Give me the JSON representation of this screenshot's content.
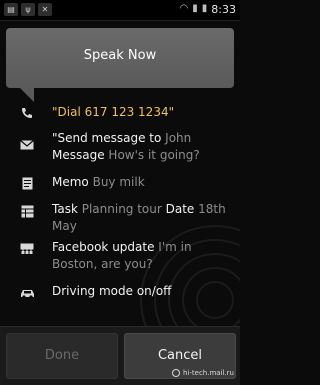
{
  "status_bar": {
    "time": "8:33",
    "left_icons": [
      "sim-icon",
      "usb-icon",
      "notification-icon"
    ],
    "right_icons": [
      "wifi-icon",
      "signal-icon",
      "battery-icon"
    ]
  },
  "prompt": {
    "title": "Speak Now"
  },
  "suggestions": [
    {
      "icon": "phone-icon",
      "parts": [
        {
          "text": "\"Dial ",
          "style": "y"
        },
        {
          "text": "617 123 1234\"",
          "style": "g"
        }
      ]
    },
    {
      "icon": "envelope-icon",
      "parts": [
        {
          "text": "\"Send message to ",
          "style": "w"
        },
        {
          "text": "John",
          "style": "g"
        },
        {
          "text": " Message ",
          "style": "w"
        },
        {
          "text": "How's it going?",
          "style": "g"
        }
      ]
    },
    {
      "icon": "memo-icon",
      "parts": [
        {
          "text": "Memo ",
          "style": "w"
        },
        {
          "text": "Buy milk",
          "style": "g"
        }
      ]
    },
    {
      "icon": "task-icon",
      "parts": [
        {
          "text": "Task ",
          "style": "w"
        },
        {
          "text": "Planning tour ",
          "style": "g"
        },
        {
          "text": "Date ",
          "style": "w"
        },
        {
          "text": "18th May",
          "style": "g"
        }
      ]
    },
    {
      "icon": "facebook-icon",
      "parts": [
        {
          "text": "Facebook update ",
          "style": "w"
        },
        {
          "text": "I'm in Boston, are you?",
          "style": "g"
        }
      ]
    },
    {
      "icon": "car-icon",
      "parts": [
        {
          "text": "Driving mode on/off",
          "style": "w"
        }
      ]
    }
  ],
  "buttons": {
    "done": "Done",
    "cancel": "Cancel"
  },
  "watermark": "hi-tech.mail.ru",
  "colors": {
    "accent_yellow": "#f0c24a",
    "hint_gray": "#8d8d8d",
    "bubble": "#5f5f5f"
  }
}
